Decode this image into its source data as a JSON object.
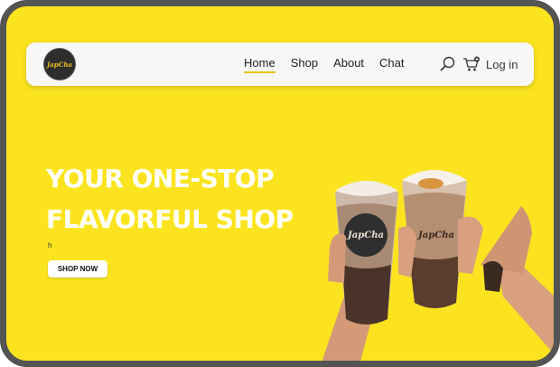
{
  "brand": {
    "logo_text": "JapCha"
  },
  "nav": {
    "links": [
      {
        "label": "Home",
        "active": true
      },
      {
        "label": "Shop",
        "active": false
      },
      {
        "label": "About",
        "active": false
      },
      {
        "label": "Chat",
        "active": false
      }
    ],
    "search_icon": "search-icon",
    "cart_icon": "cart-icon",
    "login_label": "Log in"
  },
  "hero": {
    "headline_line1": "YOUR ONE-STOP",
    "headline_line2": "FLAVORFUL SHOP",
    "tagline": "h",
    "cta_label": "SHOP NOW",
    "cup_label_left": "JapCha",
    "cup_label_right": "JapCha"
  },
  "colors": {
    "background": "#fbe41f",
    "frame": "#545454",
    "navbar": "#f7f7f7",
    "accent": "#e7c40e",
    "headline": "#ffffff"
  }
}
